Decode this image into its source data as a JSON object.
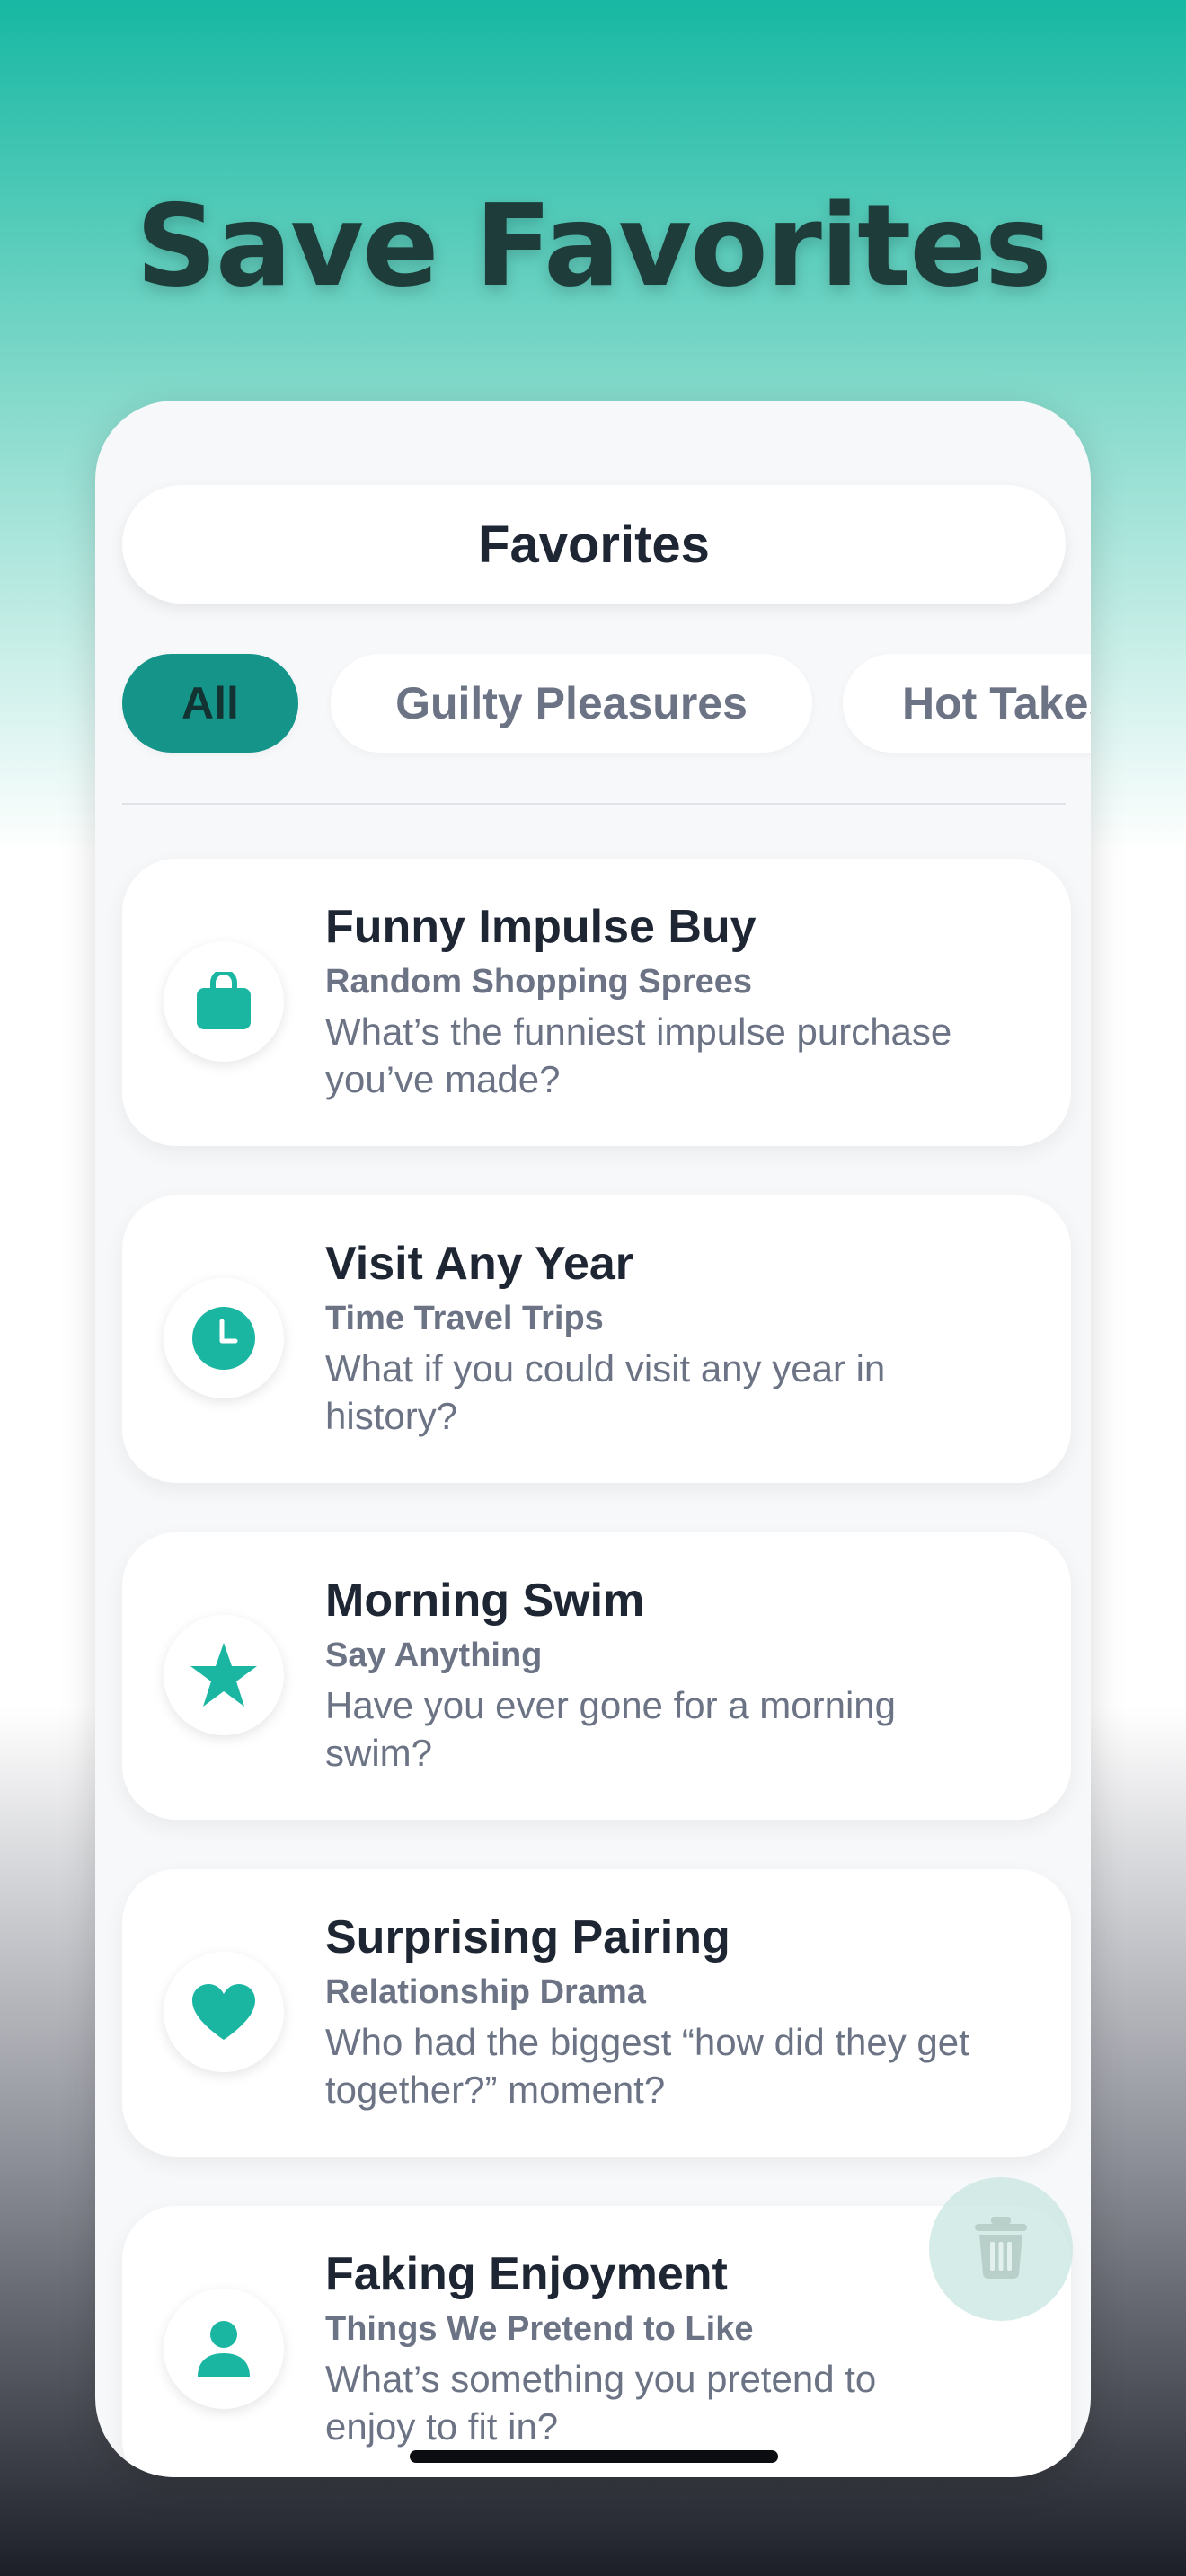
{
  "headline": "Save Favorites",
  "screen": {
    "title": "Favorites",
    "tabs": [
      {
        "label": "All",
        "active": true
      },
      {
        "label": "Guilty Pleasures",
        "active": false
      },
      {
        "label": "Hot Takes",
        "active": false
      }
    ],
    "cards": [
      {
        "title": "Funny Impulse Buy",
        "category": "Random Shopping Sprees",
        "question": "What’s the funniest impulse purchase you’ve made?",
        "icon": "shopping-bag-icon"
      },
      {
        "title": "Visit Any Year",
        "category": "Time Travel Trips",
        "question": "What if you could visit any year in history?",
        "icon": "clock-icon"
      },
      {
        "title": "Morning Swim",
        "category": "Say Anything",
        "question": "Have you ever gone for a morning swim?",
        "icon": "star-icon"
      },
      {
        "title": "Surprising Pairing",
        "category": "Relationship Drama",
        "question": "Who had the biggest “how did they get together?” moment?",
        "icon": "heart-icon"
      },
      {
        "title": "Faking Enjoyment",
        "category": "Things We Pretend to Like",
        "question": "What’s something you pretend to enjoy to fit in?",
        "icon": "person-icon"
      }
    ],
    "fab_icon": "trash-icon"
  },
  "colors": {
    "accent": "#1bb6a2",
    "active_tab": "#15958a",
    "title_text": "#1f2633",
    "muted_text": "#6b7385",
    "headline_text": "#1e3d3a"
  }
}
